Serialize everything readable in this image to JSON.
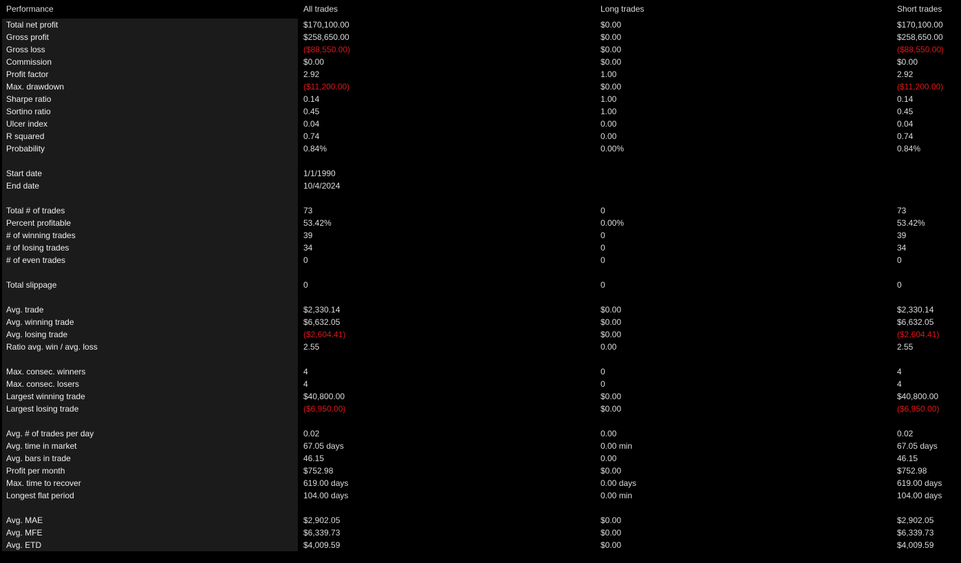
{
  "header": {
    "label": "Performance",
    "columns": [
      "All trades",
      "Long trades",
      "Short trades"
    ]
  },
  "colors": {
    "negative": "#e0161a",
    "text": "#dcdcdc",
    "panel": "#1b1b1b",
    "background": "#000000"
  },
  "groups": [
    [
      {
        "label": "Total net profit",
        "all": "$170,100.00",
        "long": "$0.00",
        "short": "$170,100.00"
      },
      {
        "label": "Gross profit",
        "all": "$258,650.00",
        "long": "$0.00",
        "short": "$258,650.00"
      },
      {
        "label": "Gross loss",
        "all": "($88,550.00)",
        "long": "$0.00",
        "short": "($88,550.00)",
        "neg": true
      },
      {
        "label": "Commission",
        "all": "$0.00",
        "long": "$0.00",
        "short": "$0.00"
      },
      {
        "label": "Profit factor",
        "all": "2.92",
        "long": "1.00",
        "short": "2.92"
      },
      {
        "label": "Max. drawdown",
        "all": "($11,200.00)",
        "long": "$0.00",
        "short": "($11,200.00)",
        "neg": true
      },
      {
        "label": "Sharpe ratio",
        "all": "0.14",
        "long": "1.00",
        "short": "0.14"
      },
      {
        "label": "Sortino ratio",
        "all": "0.45",
        "long": "1.00",
        "short": "0.45"
      },
      {
        "label": "Ulcer index",
        "all": "0.04",
        "long": "0.00",
        "short": "0.04"
      },
      {
        "label": "R squared",
        "all": "0.74",
        "long": "0.00",
        "short": "0.74"
      },
      {
        "label": "Probability",
        "all": "0.84%",
        "long": "0.00%",
        "short": "0.84%"
      }
    ],
    [
      {
        "label": "Start date",
        "all": "1/1/1990",
        "long": "",
        "short": ""
      },
      {
        "label": "End date",
        "all": "10/4/2024",
        "long": "",
        "short": ""
      }
    ],
    [
      {
        "label": "Total # of trades",
        "all": "73",
        "long": "0",
        "short": "73"
      },
      {
        "label": "Percent profitable",
        "all": "53.42%",
        "long": "0.00%",
        "short": "53.42%"
      },
      {
        "label": "# of winning trades",
        "all": "39",
        "long": "0",
        "short": "39"
      },
      {
        "label": "# of losing trades",
        "all": "34",
        "long": "0",
        "short": "34"
      },
      {
        "label": "# of even trades",
        "all": "0",
        "long": "0",
        "short": "0"
      }
    ],
    [
      {
        "label": "Total slippage",
        "all": "0",
        "long": "0",
        "short": "0"
      }
    ],
    [
      {
        "label": "Avg. trade",
        "all": "$2,330.14",
        "long": "$0.00",
        "short": "$2,330.14"
      },
      {
        "label": "Avg. winning trade",
        "all": "$6,632.05",
        "long": "$0.00",
        "short": "$6,632.05"
      },
      {
        "label": "Avg. losing trade",
        "all": "($2,604.41)",
        "long": "$0.00",
        "short": "($2,604.41)",
        "neg": true
      },
      {
        "label": "Ratio avg. win / avg. loss",
        "all": "2.55",
        "long": "0.00",
        "short": "2.55"
      }
    ],
    [
      {
        "label": "Max. consec. winners",
        "all": "4",
        "long": "0",
        "short": "4"
      },
      {
        "label": "Max. consec. losers",
        "all": "4",
        "long": "0",
        "short": "4"
      },
      {
        "label": "Largest winning trade",
        "all": "$40,800.00",
        "long": "$0.00",
        "short": "$40,800.00"
      },
      {
        "label": "Largest losing trade",
        "all": "($6,950.00)",
        "long": "$0.00",
        "short": "($6,950.00)",
        "neg": true
      }
    ],
    [
      {
        "label": "Avg. # of trades per day",
        "all": "0.02",
        "long": "0.00",
        "short": "0.02"
      },
      {
        "label": "Avg. time in market",
        "all": "67.05 days",
        "long": "0.00 min",
        "short": "67.05 days"
      },
      {
        "label": "Avg. bars in trade",
        "all": "46.15",
        "long": "0.00",
        "short": "46.15"
      },
      {
        "label": "Profit per month",
        "all": "$752.98",
        "long": "$0.00",
        "short": "$752.98"
      },
      {
        "label": "Max. time to recover",
        "all": "619.00 days",
        "long": "0.00 days",
        "short": "619.00 days"
      },
      {
        "label": "Longest flat period",
        "all": "104.00 days",
        "long": "0.00 min",
        "short": "104.00 days"
      }
    ],
    [
      {
        "label": "Avg. MAE",
        "all": "$2,902.05",
        "long": "$0.00",
        "short": "$2,902.05"
      },
      {
        "label": "Avg. MFE",
        "all": "$6,339.73",
        "long": "$0.00",
        "short": "$6,339.73"
      },
      {
        "label": "Avg. ETD",
        "all": "$4,009.59",
        "long": "$0.00",
        "short": "$4,009.59"
      }
    ]
  ]
}
